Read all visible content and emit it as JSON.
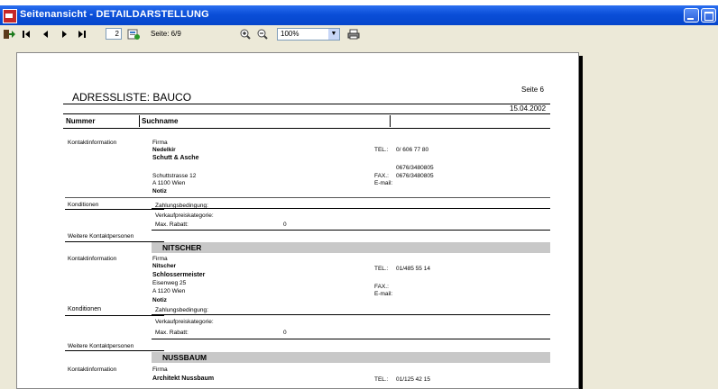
{
  "window": {
    "title": "Seitenansicht - DETAILDARSTELLUNG"
  },
  "toolbar": {
    "page_input": "2",
    "page_label": "Seite: 6/9",
    "zoom": "100%"
  },
  "icons": [
    "exit-icon",
    "first-page-icon",
    "prev-page-icon",
    "next-page-icon",
    "last-page-icon",
    "goto-page-icon",
    "zoom-in-icon",
    "zoom-out-icon",
    "print-icon"
  ],
  "report": {
    "page_label": "Seite 6",
    "title": "ADRESSLISTE: BAUCO",
    "date": "15.04.2002",
    "col_nummer": "Nummer",
    "col_suchname": "Suchname",
    "entries": [
      {
        "section_label": "Kontaktinformation",
        "firma_label": "Firma",
        "firma": "Nedelkir",
        "name": "Schutt & Asche",
        "street": "Schuttstrasse 12",
        "city": "A   1100   Wien",
        "notiz": "Notiz",
        "tel_label": "TEL.:",
        "tel": "0/ 606 77 80",
        "phone2": "0676/3480805",
        "fax_label": "FAX.:",
        "fax": "0676/3480805",
        "email_label": "E-mail:",
        "konditionen": "Konditionen",
        "zahlung": "Zahlungsbedingung:",
        "verkauf": "Verkaufpreiskategorie:",
        "rabatt": "Max. Rabatt:",
        "rabatt_value": "0",
        "weitere": "Weitere Kontaktpersonen"
      },
      {
        "bar": "NITSCHER",
        "section_label": "Kontaktinformation",
        "firma_label": "Firma",
        "firma": "Nitscher",
        "name": "Schlossermeister",
        "street": "Eisenweg 25",
        "city": "A   1120   Wien",
        "notiz": "Notiz",
        "tel_label": "TEL.:",
        "tel": "01/485 55 14",
        "fax_label": "FAX.:",
        "email_label": "E-mail:",
        "konditionen": "Konditionen",
        "zahlung": "Zahlungsbedingung:",
        "verkauf": "Verkaufpreiskategorie:",
        "rabatt": "Max. Rabatt:",
        "rabatt_value": "0",
        "weitere": "Weitere Kontaktpersonen"
      },
      {
        "bar": "NUSSBAUM",
        "section_label": "Kontaktinformation",
        "firma_label": "Firma",
        "name": "Architekt Nussbaum",
        "tel_label": "TEL.:",
        "tel": "01/125 42 15"
      }
    ]
  }
}
